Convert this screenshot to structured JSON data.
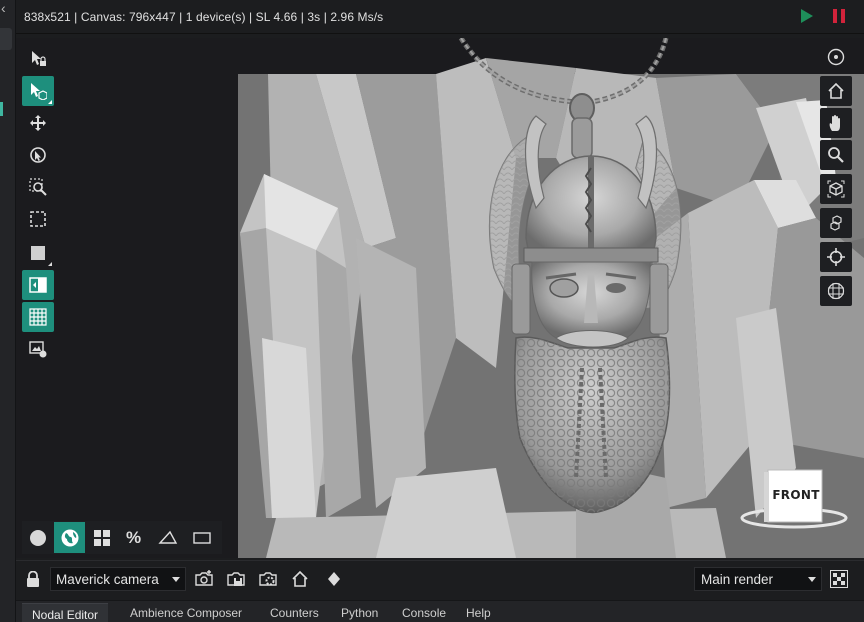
{
  "status_bar": {
    "text": "838x521 | Canvas: 796x447 | 1 device(s) | SL 4.66 | 3s | 2.96 Ms/s",
    "play_icon": "play-icon",
    "pause_icon": "pause-icon",
    "play_color": "#1e8f5a",
    "pause_color": "#d2233b"
  },
  "left_toolbar": {
    "tools": [
      {
        "icon": "lock-select-icon",
        "active": false
      },
      {
        "icon": "object-select-icon",
        "active": true
      },
      {
        "icon": "move-icon",
        "active": false
      },
      {
        "icon": "focus-pick-icon",
        "active": false
      },
      {
        "icon": "zoom-region-icon",
        "active": false
      },
      {
        "icon": "region-select-icon",
        "active": false
      },
      {
        "icon": "region-render-icon",
        "active": false
      },
      {
        "icon": "split-view-icon",
        "active": true
      },
      {
        "icon": "grid-overlay-icon",
        "active": true
      },
      {
        "icon": "image-settings-icon",
        "active": false
      }
    ]
  },
  "right_toolbar": {
    "tools": [
      "focus-target-icon",
      "home-icon",
      "pan-hand-icon",
      "zoom-icon",
      "fit-object-icon",
      "fit-scene-icon",
      "crosshair-icon",
      "grid-sphere-icon"
    ]
  },
  "viewport": {
    "orientation_label": "FRONT",
    "accent_color": "#1e8f7d"
  },
  "render_modes": {
    "items": [
      "solid-sphere-icon",
      "globe-icon",
      "quad-view-icon",
      "fraction-icon",
      "triangle-icon",
      "rectangle-icon"
    ],
    "fraction_glyph": "%",
    "active_index": 1
  },
  "camera_bar": {
    "lock_icon": "lock-icon",
    "camera_value": "Maverick camera",
    "buttons": [
      "camera-add-icon",
      "camera-save-icon",
      "camera-settings-icon",
      "camera-home-icon",
      "keyframe-icon"
    ],
    "render_value": "Main render",
    "grid_icon": "checker-grid-icon"
  },
  "tabs": [
    "Nodal Editor",
    "Ambience Composer",
    "Counters",
    "Python",
    "Console",
    "Help"
  ],
  "active_tab": 0
}
